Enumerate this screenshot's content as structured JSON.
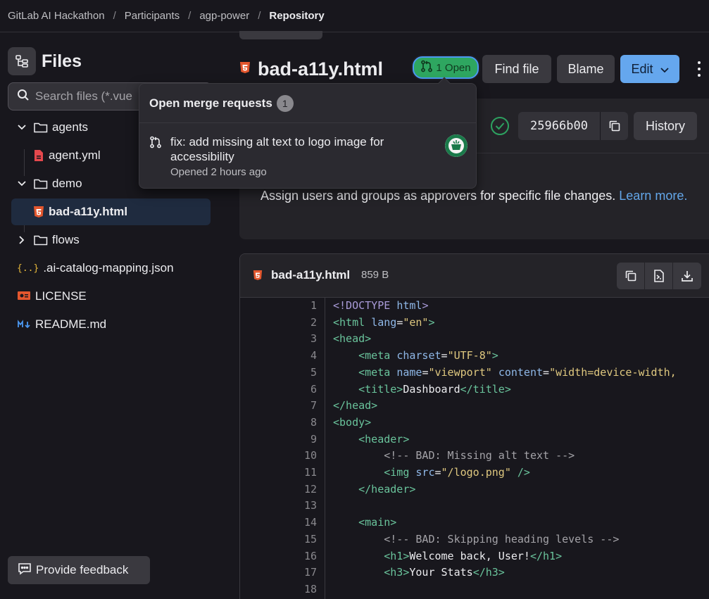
{
  "breadcrumb": [
    "GitLab AI Hackathon",
    "Participants",
    "agp-power",
    "Repository"
  ],
  "sidebar": {
    "title": "Files",
    "search_placeholder": "Search files (*.vue",
    "tree": [
      {
        "label": "agents",
        "type": "folder",
        "open": true
      },
      {
        "label": "agent.yml",
        "type": "file",
        "icon": "yaml-file-icon"
      },
      {
        "label": "demo",
        "type": "folder",
        "open": true
      },
      {
        "label": "bad-a11y.html",
        "type": "file",
        "icon": "html5-icon",
        "selected": true
      },
      {
        "label": "flows",
        "type": "folder",
        "open": false
      },
      {
        "label": ".ai-catalog-mapping.json",
        "type": "file",
        "icon": "json-icon"
      },
      {
        "label": "LICENSE",
        "type": "file",
        "icon": "license-icon"
      },
      {
        "label": "README.md",
        "type": "file",
        "icon": "markdown-icon"
      }
    ],
    "feedback_label": "Provide feedback"
  },
  "header": {
    "file_name": "bad-a11y.html",
    "mr_badge": "1 Open",
    "find_file": "Find file",
    "blame": "Blame",
    "edit": "Edit"
  },
  "commit": {
    "sha": "25966b00",
    "history": "History",
    "approvers_text": "Assign users and groups as approvers for specific file changes.",
    "learn_more": "Learn more."
  },
  "popover": {
    "title": "Open merge requests",
    "count": "1",
    "mr_title": "fix: add missing alt text to logo image for accessibility",
    "mr_status": "Opened 2 hours ago"
  },
  "code": {
    "file_name": "bad-a11y.html",
    "file_size": "859 B",
    "lines": [
      "1",
      "2",
      "3",
      "4",
      "5",
      "6",
      "7",
      "8",
      "9",
      "10",
      "11",
      "12",
      "13",
      "14",
      "15",
      "16",
      "17",
      "18"
    ]
  },
  "colors": {
    "background": "#18171d",
    "accent_blue": "#65a7ee",
    "success_green": "#2ea660",
    "html_icon_orange": "#e4572e"
  }
}
